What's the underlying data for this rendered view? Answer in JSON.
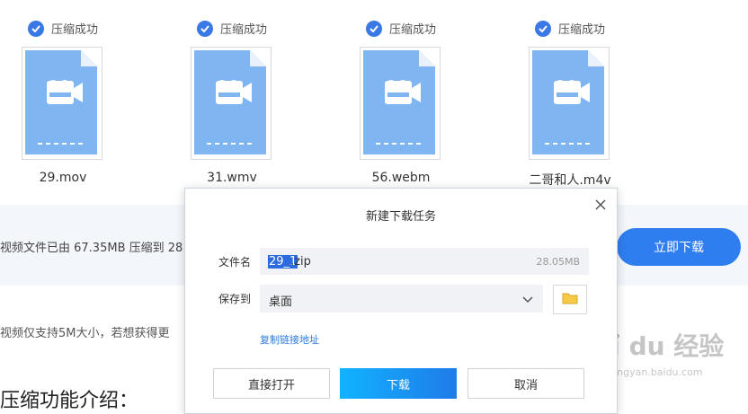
{
  "files": [
    {
      "status": "压缩成功",
      "name": "29.mov"
    },
    {
      "status": "压缩成功",
      "name": "31.wmv"
    },
    {
      "status": "压缩成功",
      "name": "56.webm"
    },
    {
      "status": "压缩成功",
      "name": "二哥和人.m4v"
    }
  ],
  "page": {
    "band_text": "视频文件已由 67.35MB 压缩到 28",
    "download_now": "立即下载",
    "note_text": "视频仅支持5M大小，若想获得更",
    "note_tail": "。",
    "section_title": "压缩功能介绍："
  },
  "dialog": {
    "title": "新建下载任务",
    "filename_label": "文件名",
    "filename_selected": "29_1",
    "filename_ext": ".zip",
    "file_size": "28.05MB",
    "save_label": "保存到",
    "save_location": "桌面",
    "copy_link": "复制链接地址",
    "open_button": "直接打开",
    "download_button": "下载",
    "cancel_button": "取消"
  },
  "watermark": {
    "brand": "Bai du 经验",
    "url": "jingyan.baidu.com"
  },
  "colors": {
    "accent": "#2f7ef0",
    "file_icon": "#7fb6f2",
    "check": "#3a78e6"
  }
}
